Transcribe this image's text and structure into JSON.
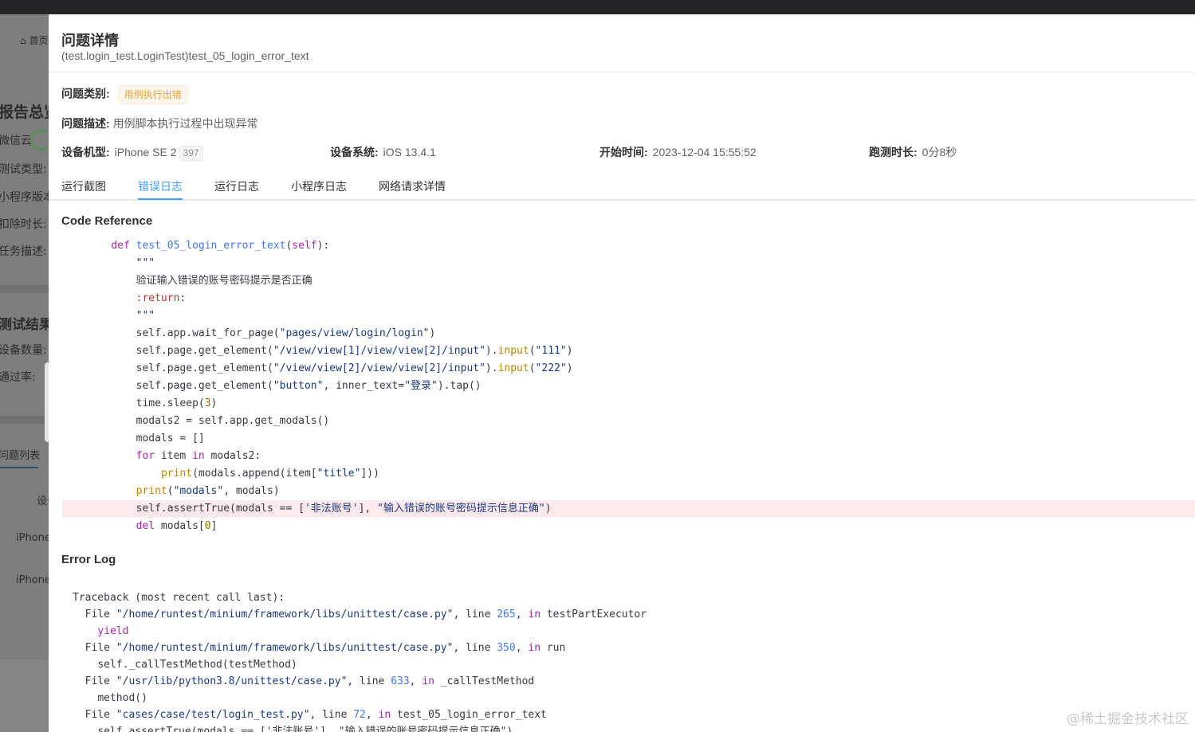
{
  "background": {
    "home_label": "首页",
    "report_title": "报告总览",
    "cloud_label": "微信云",
    "test_type_label": "测试类型:",
    "mp_version_label": "小程序版本",
    "deduct_label": "扣除时长:",
    "task_desc_label": "任务描述:",
    "result_title": "测试结果",
    "device_count_label": "设备数量:",
    "pass_rate_label": "通过率:",
    "issue_list_tab": "问题列表",
    "col_device": "设备",
    "row_1_device": "iPhone",
    "row_2_device": "iPhone"
  },
  "drawer": {
    "title": "问题详情",
    "subtitle": "(test.login_test.LoginTest)test_05_login_error_text",
    "category_label": "问题类别:",
    "category_tag": "用例执行出错",
    "description_label": "问题描述:",
    "description_value": "用例脚本执行过程中出现异常",
    "device_model_label": "设备机型:",
    "device_model_value": "iPhone SE 2",
    "device_model_badge": "397",
    "device_os_label": "设备系统:",
    "device_os_value": "iOS 13.4.1",
    "start_time_label": "开始时间:",
    "start_time_value": "2023-12-04 15:55:52",
    "duration_label": "跑测时长:",
    "duration_value": "0分8秒"
  },
  "tabs": [
    {
      "label": "运行截图",
      "active": false
    },
    {
      "label": "错误日志",
      "active": true
    },
    {
      "label": "运行日志",
      "active": false
    },
    {
      "label": "小程序日志",
      "active": false
    },
    {
      "label": "网络请求详情",
      "active": false
    }
  ],
  "code_reference": {
    "title": "Code Reference",
    "lines": [
      {
        "indent": 4,
        "parts": [
          [
            "kw",
            "def "
          ],
          [
            "fn",
            "test_05_login_error_text"
          ],
          [
            "",
            "("
          ],
          [
            "kw",
            "self"
          ],
          [
            "",
            "):"
          ]
        ]
      },
      {
        "indent": 8,
        "parts": [
          [
            "str",
            "\"\"\""
          ]
        ]
      },
      {
        "indent": 8,
        "parts": [
          [
            "",
            "验证输入错误的账号密码提示是否正确"
          ]
        ]
      },
      {
        "indent": 8,
        "parts": [
          [
            "rt",
            ":return"
          ],
          [
            "",
            ":"
          ]
        ]
      },
      {
        "indent": 8,
        "parts": [
          [
            "str",
            "\"\"\""
          ]
        ]
      },
      {
        "indent": 8,
        "parts": [
          [
            "",
            "self.app.wait_for_page("
          ],
          [
            "str",
            "\"pages/view/login/login\""
          ],
          [
            "",
            ")"
          ]
        ]
      },
      {
        "indent": 8,
        "parts": [
          [
            "",
            "self.page.get_element("
          ],
          [
            "str",
            "\"/view/view[1]/view/view[2]/input\""
          ],
          [
            "",
            ")."
          ],
          [
            "bi",
            "input"
          ],
          [
            "",
            "("
          ],
          [
            "str",
            "\"111\""
          ],
          [
            "",
            ")"
          ]
        ]
      },
      {
        "indent": 8,
        "parts": [
          [
            "",
            "self.page.get_element("
          ],
          [
            "str",
            "\"/view/view[2]/view/view[2]/input\""
          ],
          [
            "",
            ")."
          ],
          [
            "bi",
            "input"
          ],
          [
            "",
            "("
          ],
          [
            "str",
            "\"222\""
          ],
          [
            "",
            ")"
          ]
        ]
      },
      {
        "indent": 8,
        "parts": [
          [
            "",
            "self.page.get_element("
          ],
          [
            "str",
            "\"button\""
          ],
          [
            "",
            ", inner_text="
          ],
          [
            "str",
            "\"登录\""
          ],
          [
            "",
            ").tap()"
          ]
        ]
      },
      {
        "indent": 8,
        "parts": [
          [
            "",
            "time.sleep("
          ],
          [
            "num",
            "3"
          ],
          [
            "",
            ")"
          ]
        ]
      },
      {
        "indent": 8,
        "parts": [
          [
            "",
            "modals2 = self.app.get_modals()"
          ]
        ]
      },
      {
        "indent": 8,
        "parts": [
          [
            "",
            "modals = []"
          ]
        ]
      },
      {
        "indent": 8,
        "parts": [
          [
            "kw",
            "for"
          ],
          [
            "",
            " item "
          ],
          [
            "kw",
            "in"
          ],
          [
            "",
            " modals2:"
          ]
        ]
      },
      {
        "indent": 12,
        "parts": [
          [
            "bi",
            "print"
          ],
          [
            "",
            "(modals.append(item["
          ],
          [
            "str",
            "\"title\""
          ],
          [
            "",
            "]))"
          ]
        ]
      },
      {
        "indent": 8,
        "parts": [
          [
            "bi",
            "print"
          ],
          [
            "",
            "("
          ],
          [
            "str",
            "\"modals\""
          ],
          [
            "",
            ", modals)"
          ]
        ]
      },
      {
        "indent": 8,
        "highlight": true,
        "parts": [
          [
            "",
            "self.assertTrue(modals == ["
          ],
          [
            "str",
            "'非法账号'"
          ],
          [
            "",
            "], "
          ],
          [
            "str",
            "\"输入错误的账号密码提示信息正确\""
          ],
          [
            "",
            ")"
          ]
        ]
      },
      {
        "indent": 8,
        "parts": [
          [
            "kw",
            "del"
          ],
          [
            "",
            " modals["
          ],
          [
            "num",
            "0"
          ],
          [
            "",
            "]"
          ]
        ]
      }
    ]
  },
  "error_log": {
    "title": "Error Log",
    "lines": [
      {
        "indent": 0,
        "parts": [
          [
            "",
            "Traceback (most recent call last):"
          ]
        ]
      },
      {
        "indent": 2,
        "parts": [
          [
            "",
            "File "
          ],
          [
            "path",
            "\"/home/runtest/minium/framework/libs/unittest/case.py\""
          ],
          [
            "",
            ", line "
          ],
          [
            "tnum",
            "265"
          ],
          [
            "",
            ", "
          ],
          [
            "tkw",
            "in"
          ],
          [
            "",
            " testPartExecutor"
          ]
        ]
      },
      {
        "indent": 4,
        "parts": [
          [
            "yld",
            "yield"
          ]
        ]
      },
      {
        "indent": 2,
        "parts": [
          [
            "",
            "File "
          ],
          [
            "path",
            "\"/home/runtest/minium/framework/libs/unittest/case.py\""
          ],
          [
            "",
            ", line "
          ],
          [
            "tnum",
            "350"
          ],
          [
            "",
            ", "
          ],
          [
            "tkw",
            "in"
          ],
          [
            "",
            " run"
          ]
        ]
      },
      {
        "indent": 4,
        "parts": [
          [
            "",
            "self._callTestMethod(testMethod)"
          ]
        ]
      },
      {
        "indent": 2,
        "parts": [
          [
            "",
            "File "
          ],
          [
            "path",
            "\"/usr/lib/python3.8/unittest/case.py\""
          ],
          [
            "",
            ", line "
          ],
          [
            "tnum",
            "633"
          ],
          [
            "",
            ", "
          ],
          [
            "tkw",
            "in"
          ],
          [
            "",
            " _callTestMethod"
          ]
        ]
      },
      {
        "indent": 4,
        "parts": [
          [
            "",
            "method()"
          ]
        ]
      },
      {
        "indent": 2,
        "parts": [
          [
            "",
            "File "
          ],
          [
            "path",
            "\"cases/case/test/login_test.py\""
          ],
          [
            "",
            ", line "
          ],
          [
            "tnum",
            "72"
          ],
          [
            "",
            ", "
          ],
          [
            "tkw",
            "in"
          ],
          [
            "",
            " test_05_login_error_text"
          ]
        ]
      },
      {
        "indent": 4,
        "parts": [
          [
            "",
            "self.assertTrue(modals == ['非法账号'], \"输入错误的账号密码提示信息正确\")"
          ]
        ]
      }
    ]
  },
  "watermark": "@稀土掘金技术社区",
  "colors": {
    "accent": "#409eff",
    "warning_tag": "#e6a23c",
    "highlight_row": "#fbe9eb"
  }
}
